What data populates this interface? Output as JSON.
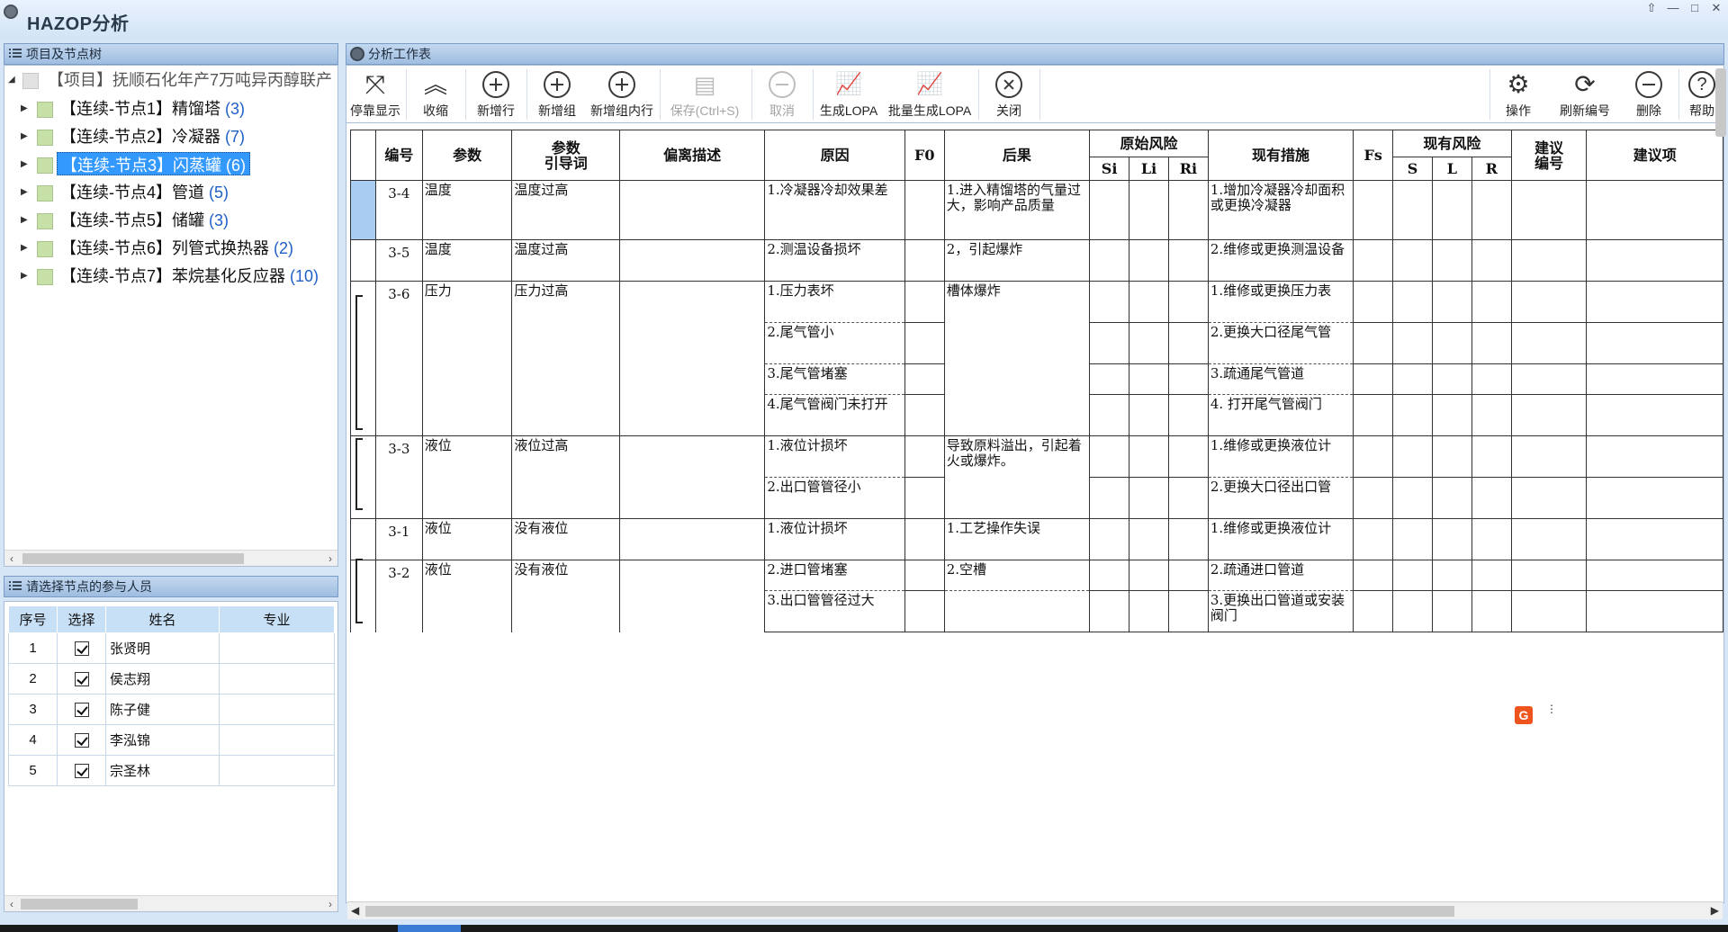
{
  "window": {
    "title": "HAZOP分析",
    "controls": [
      "⇧",
      "—",
      "□",
      "✕"
    ]
  },
  "tree_panel": {
    "title": "项目及节点树",
    "root": "【项目】抚顺石化年产7万吨异丙醇联产",
    "nodes": [
      {
        "label": "【连续-节点1】精馏塔 ",
        "count": "(3)"
      },
      {
        "label": "【连续-节点2】冷凝器 ",
        "count": "(7)"
      },
      {
        "label": "【连续-节点3】闪蒸罐 ",
        "count": "(6)"
      },
      {
        "label": "【连续-节点4】管道 ",
        "count": "(5)"
      },
      {
        "label": "【连续-节点5】储罐 ",
        "count": "(3)"
      },
      {
        "label": "【连续-节点6】列管式换热器 ",
        "count": "(2)"
      },
      {
        "label": "【连续-节点7】苯烷基化反应器 ",
        "count": "(10)"
      }
    ],
    "selected_index": 2
  },
  "participants_panel": {
    "title": "请选择节点的参与人员",
    "columns": [
      "序号",
      "选择",
      "姓名",
      "专业"
    ],
    "rows": [
      {
        "no": "1",
        "checked": true,
        "name": "张贤明",
        "specialty": ""
      },
      {
        "no": "2",
        "checked": true,
        "name": "侯志翔",
        "specialty": ""
      },
      {
        "no": "3",
        "checked": true,
        "name": "陈子健",
        "specialty": ""
      },
      {
        "no": "4",
        "checked": true,
        "name": "李泓锦",
        "specialty": ""
      },
      {
        "no": "5",
        "checked": true,
        "name": "宗圣林",
        "specialty": ""
      }
    ]
  },
  "worksheet": {
    "title": "分析工作表",
    "toolbar": {
      "dock": "停靠显示",
      "collapse": "收缩",
      "add_row": "新增行",
      "add_group": "新增组",
      "add_group_row": "新增组内行",
      "save": "保存(Ctrl+S)",
      "cancel": "取消",
      "gen_lopa": "生成LOPA",
      "batch_lopa": "批量生成LOPA",
      "close": "关闭",
      "operate": "操作",
      "renumber": "刷新编号",
      "delete": "删除",
      "help": "帮助"
    },
    "headers": {
      "no": "编号",
      "param": "参数",
      "guideword": "参数\n引导词",
      "deviation": "偏离描述",
      "cause": "原因",
      "f0": "F0",
      "consequence": "后果",
      "orig_risk": "原始风险",
      "si": "Si",
      "li": "Li",
      "ri": "Ri",
      "measures": "现有措施",
      "fs": "Fs",
      "cur_risk": "现有风险",
      "s": "S",
      "l": "L",
      "r": "R",
      "sugg_no": "建议\n编号",
      "sugg": "建议项"
    },
    "rows": [
      {
        "no": "3-4",
        "param": "温度",
        "guide": "温度过高",
        "cause": "1.冷凝器冷却效果差",
        "cons": "1.进入精馏塔的气量过大，影响产品质量",
        "meas": "1.增加冷凝器冷却面积或更换冷凝器"
      },
      {
        "no": "3-5",
        "param": "温度",
        "guide": "温度过高",
        "cause": "2.测温设备损坏",
        "cons": "2，引起爆炸",
        "meas": "2.维修或更换测温设备"
      },
      {
        "no": "3-6",
        "param": "压力",
        "guide": "压力过高",
        "cause": "1.压力表坏",
        "cons": "槽体爆炸",
        "meas": "1.维修或更换压力表"
      },
      {
        "cause": "2.尾气管小",
        "meas": "2.更换大口径尾气管"
      },
      {
        "cause": "3.尾气管堵塞",
        "meas": "3.疏通尾气管道"
      },
      {
        "cause": "4.尾气管阀门未打开",
        "meas": "4.  打开尾气管阀门"
      },
      {
        "no": "3-3",
        "param": "液位",
        "guide": "液位过高",
        "cause": "1.液位计损坏",
        "cons": "导致原料溢出，引起着火或爆炸。",
        "meas": "1.维修或更换液位计"
      },
      {
        "cause": "2.出口管管径小",
        "meas": "2.更换大口径出口管"
      },
      {
        "no": "3-1",
        "param": "液位",
        "guide": "没有液位",
        "cause": "1.液位计损坏",
        "cons": "1.工艺操作失误",
        "meas": "1.维修或更换液位计"
      },
      {
        "no": "3-2",
        "param": "液位",
        "guide": "没有液位",
        "cause": "2.进口管堵塞",
        "cons": "2.空槽",
        "meas": "2.疏通进口管道"
      },
      {
        "cause": "3.出口管管径过大",
        "meas": "3.更换出口管道或安装阀门"
      }
    ]
  },
  "badge": {
    "letter": "G",
    "menu": "⋮"
  },
  "colors": {
    "selection": "#3399ff",
    "tree_box": "#c6e0a8",
    "header": "#c8e0f6",
    "badge": "#f0541e"
  }
}
